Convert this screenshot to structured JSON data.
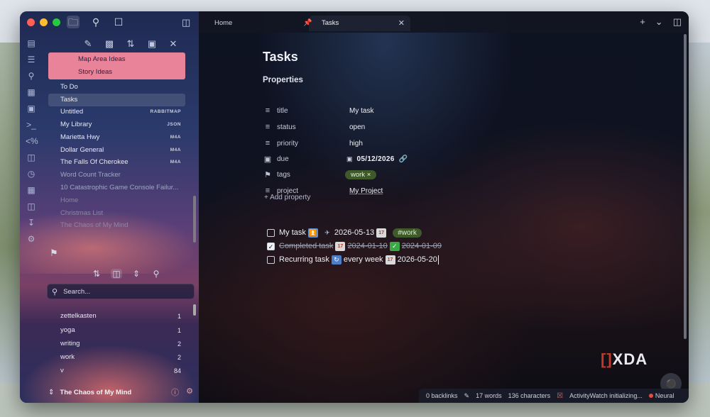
{
  "tabs": [
    {
      "label": "Home"
    },
    {
      "label": "Tasks"
    }
  ],
  "sidebar": {
    "tree": [
      {
        "label": "Map Area Ideas",
        "ext": "",
        "style": "sub"
      },
      {
        "label": "Story Ideas",
        "ext": "",
        "style": "sub"
      },
      {
        "label": "To Do",
        "ext": "",
        "style": ""
      },
      {
        "label": "Tasks",
        "ext": "",
        "style": "active"
      },
      {
        "label": "Untitled",
        "ext": "RABBITMAP",
        "style": ""
      },
      {
        "label": "My Library",
        "ext": "JSON",
        "style": ""
      },
      {
        "label": "Marietta Hwy",
        "ext": "M4A",
        "style": ""
      },
      {
        "label": "Dollar General",
        "ext": "M4A",
        "style": ""
      },
      {
        "label": "The Falls Of Cherokee",
        "ext": "M4A",
        "style": ""
      },
      {
        "label": "Word Count Tracker",
        "ext": "",
        "style": "dim"
      },
      {
        "label": "10 Catastrophic Game Console Failur...",
        "ext": "",
        "style": "dim"
      },
      {
        "label": "Home",
        "ext": "",
        "style": "dim2"
      },
      {
        "label": "Christmas List",
        "ext": "",
        "style": "dim2"
      },
      {
        "label": "The Chaos of My Mind",
        "ext": "",
        "style": "dim2"
      }
    ],
    "search_placeholder": "Search...",
    "tags": [
      {
        "name": "zettelkasten",
        "count": "1"
      },
      {
        "name": "yoga",
        "count": "1"
      },
      {
        "name": "writing",
        "count": "2"
      },
      {
        "name": "work",
        "count": "2"
      },
      {
        "name": "v",
        "count": "84"
      }
    ],
    "vault_name": "The Chaos of My Mind"
  },
  "note": {
    "title": "Tasks",
    "properties_heading": "Properties",
    "properties": {
      "title": {
        "key": "title",
        "value": "My task"
      },
      "status": {
        "key": "status",
        "value": "open"
      },
      "priority": {
        "key": "priority",
        "value": "high"
      },
      "due": {
        "key": "due",
        "value": "05/12/2026"
      },
      "tags": {
        "key": "tags",
        "value": "work"
      },
      "project": {
        "key": "project",
        "value": "My Project"
      }
    },
    "add_property": "Add property",
    "tasks": [
      {
        "text": "My task",
        "date": "2026-05-13",
        "tag": "#work",
        "checked": false
      },
      {
        "text": "Completed task",
        "date": "2024-01-10",
        "done_date": "2024-01-09",
        "checked": true
      },
      {
        "text": "Recurring task",
        "recurrence": "every week",
        "date": "2026-05-20",
        "checked": false
      }
    ]
  },
  "statusbar": {
    "backlinks": "0 backlinks",
    "words": "17 words",
    "characters": "136 characters",
    "activity": "ActivityWatch initializing...",
    "model": "Neural"
  },
  "watermark": "XDA",
  "colors": {
    "accent_tag": "#3e5a2b",
    "pink_folder": "#e8839a"
  }
}
